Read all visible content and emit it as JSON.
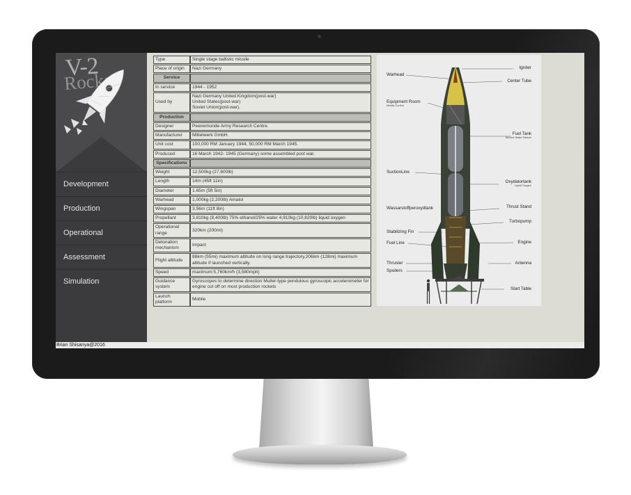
{
  "sidebar": {
    "logo_title": "V-2",
    "logo_subtitle": "Rocket",
    "nav": [
      "Development",
      "Production",
      "Operational",
      "Assessment",
      "Simulation"
    ]
  },
  "footer": "Brian Shisanya@2016",
  "infobox": [
    {
      "k": "Type",
      "v": "Single stage ballistic missile"
    },
    {
      "k": "Place of origin",
      "v": "Nazi Germany"
    },
    {
      "section": "Service"
    },
    {
      "k": "In service",
      "v": "1944 - 1952"
    },
    {
      "k": "Used by",
      "v": [
        "Nazi Germany United Kingdom(post-war)",
        "United States(post-war)",
        "Soviet Union(post-war)."
      ]
    },
    {
      "section": "Production"
    },
    {
      "k": "Designer",
      "v": "Peenemunde Army Research Centre."
    },
    {
      "k": "Manufacturer",
      "v": "Mittelwerk GmbH."
    },
    {
      "k": "Unit cost",
      "v": "100,000 RM January 1944, 50,000 RM March 1945."
    },
    {
      "k": "Produced",
      "v": "16 March 1942- 1945 (Germany) some assembled post war."
    },
    {
      "section": "Specifications"
    },
    {
      "k": "Weight",
      "v": "12,500kg (27,600lb)"
    },
    {
      "k": "Length",
      "v": "14m (45ft 11in)"
    },
    {
      "k": "Diameter",
      "v": "1.65m (5ft 5in)"
    },
    {
      "k": "Warhead",
      "v": "1,000kg (2,200lb) Amatol"
    },
    {
      "k": "Wingspan",
      "v": "3.56m (11ft 8in)"
    },
    {
      "k": "Propellant",
      "v": "3,810kg (8,400lb) 75% ethanol/25% water 4,910kg (10,820lb) liquid oxygen"
    },
    {
      "k": "Operational range",
      "v": "320km (200mi)"
    },
    {
      "k": "Detonation mechanism",
      "v": "Impact"
    },
    {
      "k": "Flight altitude",
      "v": "88km (55mi) maximum altitude on long range trajectory,206km (128mi) maximum altitude if launched vertically."
    },
    {
      "k": "Speed",
      "v": "maximum:5,760km/h (3,580mph)"
    },
    {
      "k": "Guidance system",
      "v": "Gyroscopes to determine direction Muller-type pendulous gyroscopic accelerometer for engine cut off on most production rockets"
    },
    {
      "k": "Launch platform",
      "v": "Mobile"
    }
  ],
  "diagram": {
    "labels_left": [
      {
        "text": "Warhead"
      },
      {
        "text": "Equipment Room",
        "sub": "Missile Control"
      },
      {
        "text": "SuctionLine"
      },
      {
        "text": "Wassarstoffperoxydtank"
      },
      {
        "text": "Stabilizing Fin"
      },
      {
        "text": "Fuel Line"
      },
      {
        "text": "Thruster"
      },
      {
        "text": "Spoilers"
      }
    ],
    "labels_right": [
      {
        "text": "Igniter"
      },
      {
        "text": "Center Tube"
      },
      {
        "text": "Fuel Tank",
        "sub": "Alcohol-Water Mixture"
      },
      {
        "text": "Oxydatortank",
        "sub": "Liquid Oxygen"
      },
      {
        "text": "Thrust Stand"
      },
      {
        "text": "Turbopump"
      },
      {
        "text": "Engine"
      },
      {
        "text": "Antenna"
      },
      {
        "text": "Start Table"
      }
    ]
  },
  "colors": {
    "sidebar": "#3b3b3e",
    "screen": "#dcdcd5",
    "rocket": "#2e3a2c"
  }
}
